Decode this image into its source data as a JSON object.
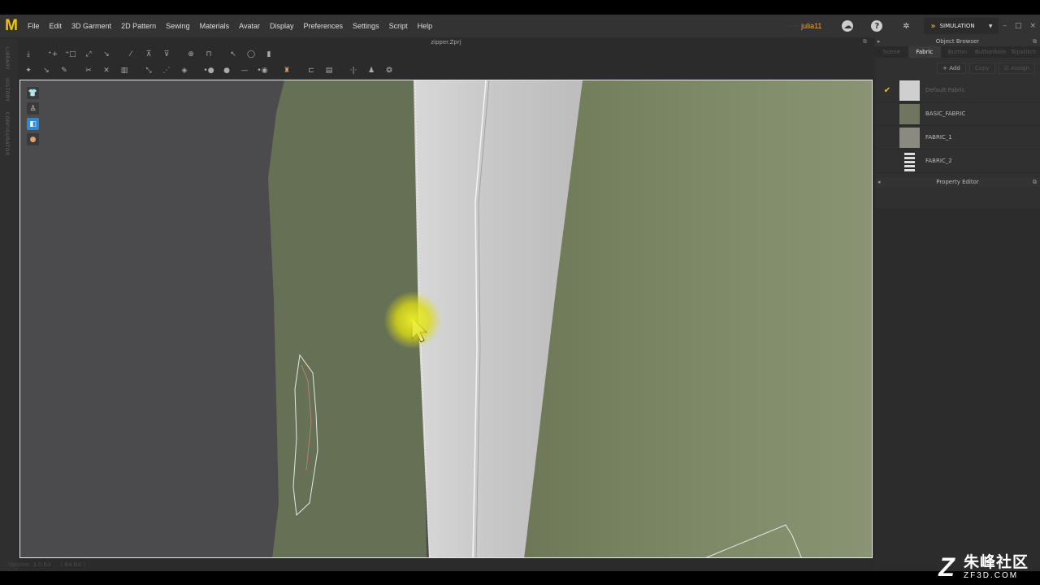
{
  "app": {
    "logo_letter": "M",
    "menu": [
      "File",
      "Edit",
      "3D Garment",
      "2D Pattern",
      "Sewing",
      "Materials",
      "Avatar",
      "Display",
      "Preferences",
      "Settings",
      "Script",
      "Help"
    ],
    "user_prefix": "·····",
    "user": "julia11",
    "mode": "SIMULATION",
    "window_controls": [
      "–",
      "□",
      "×"
    ]
  },
  "document": {
    "title": "zipper.Zprj"
  },
  "left_strip": {
    "labels": [
      "LIBRARY",
      "HISTORY",
      "CONFIGURATOR"
    ]
  },
  "toolbars": {
    "row1": [
      "download-arrow-icon",
      "move-point-icon",
      "transform-box-icon",
      "scale-icon",
      "edit-curve-icon",
      "segment-icon",
      "fold-icon",
      "fold-arrange-icon",
      "tack-icon",
      "pin-icon",
      "lasso-pin-icon",
      "measure-icon",
      "ruler-icon"
    ],
    "row2": [
      "select-mesh-icon",
      "pin-point-icon",
      "brush-icon",
      "split-icon",
      "cut-icon",
      "sew-icon",
      "stitch-icon",
      "multi-sew-icon",
      "zipper-icon",
      "button-icon",
      "line-icon",
      "hole-icon",
      "fabric-icon",
      "puckering-icon",
      "topstitch-icon",
      "thickness-icon",
      "pattern-icon",
      "avatar-icon",
      "measure-tape-icon"
    ]
  },
  "viewport": {
    "side_tools": [
      "garment-icon",
      "avatar-icon",
      "fabric-icon",
      "skin-icon"
    ],
    "colors": {
      "background": "#4b4b4e",
      "fabric": "#7c8866",
      "zipper": "#cfcfcf",
      "highlight": "#f0f020"
    }
  },
  "status_bar": {
    "version": "Version: 3.0.63",
    "extra": "( 64 Bit )"
  },
  "object_browser": {
    "title": "Object Browser",
    "tabs": [
      "Scene",
      "Fabric",
      "Button",
      "Buttonhole",
      "Topstitch"
    ],
    "active_tab": "Fabric",
    "actions": {
      "add": "+ Add",
      "copy": "Copy",
      "assign": "☑ Assign"
    },
    "fabrics": [
      {
        "name": "Default Fabric",
        "swatch": "#cfcfcf",
        "checked": true
      },
      {
        "name": "BASIC_FABRIC",
        "swatch": "#6f7560",
        "checked": false
      },
      {
        "name": "FABRIC_1",
        "swatch": "#8a8a80",
        "checked": false
      },
      {
        "name": "FABRIC_2",
        "swatch": "zipper-swatch",
        "checked": false
      }
    ]
  },
  "property_editor": {
    "title": "Property Editor"
  },
  "watermark": {
    "cn": "朱峰社区",
    "en": "ZF3D.COM",
    "logo": "Z"
  }
}
